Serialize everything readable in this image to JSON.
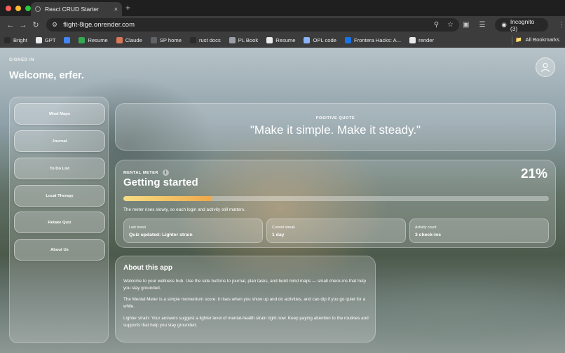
{
  "browser": {
    "tab_title": "React CRUD Starter",
    "tab_close": "×",
    "new_tab": "+",
    "url": "flight-8ige.onrender.com",
    "incognito_label": "Incognito (3)",
    "bookmarks": [
      {
        "label": "Bright",
        "color": "#2b2b2b"
      },
      {
        "label": "GPT",
        "color": "#e8eaed"
      },
      {
        "label": "",
        "color": "#4285f4"
      },
      {
        "label": "Resume",
        "color": "#34a853"
      },
      {
        "label": "Claude",
        "color": "#d97757"
      },
      {
        "label": "SP home",
        "color": "#5f6368"
      },
      {
        "label": "rust docs",
        "color": "#2b2b2b"
      },
      {
        "label": "PL Book",
        "color": "#9aa0a6"
      },
      {
        "label": "Resume",
        "color": "#e8eaed"
      },
      {
        "label": "OPL code",
        "color": "#8ab4f8"
      },
      {
        "label": "Frontera Hacks: A...",
        "color": "#1a73e8"
      },
      {
        "label": "render",
        "color": "#e8eaed"
      }
    ],
    "all_bookmarks": "All Bookmarks"
  },
  "header": {
    "signed_in": "SIGNED IN",
    "welcome": "Welcome, erfer."
  },
  "sidebar": {
    "items": [
      {
        "label": "Mind Maps"
      },
      {
        "label": "Journal"
      },
      {
        "label": "To Do List"
      },
      {
        "label": "Local Therapy"
      },
      {
        "label": "Retake Quiz"
      },
      {
        "label": "About Us"
      }
    ]
  },
  "quote": {
    "label": "POSITIVE QUOTE",
    "text": "\"Make it simple. Make it steady.\""
  },
  "meter": {
    "label": "MENTAL METER",
    "info_glyph": "i",
    "title": "Getting started",
    "percent_text": "21%",
    "progress": 0.21,
    "note": "The meter rises slowly, so each login and activity still matters.",
    "stats": [
      {
        "key": "Last boost",
        "value": "Quiz updated: Lighter strain"
      },
      {
        "key": "Current streak",
        "value": "1 day"
      },
      {
        "key": "Activity count",
        "value": "3 check-ins"
      }
    ]
  },
  "about": {
    "title": "About this app",
    "p1": "Welcome to your wellness hub. Use the side buttons to journal, plan tasks, and build mind maps — small check-ins that help you stay grounded.",
    "p2": "The Mental Meter is a simple momentum score: it rises when you show up and do activities, and can dip if you go quiet for a while.",
    "p3": "Lighter strain: Your answers suggest a lighter level of mental-health strain right now. Keep paying attention to the routines and supports that help you stay grounded."
  }
}
